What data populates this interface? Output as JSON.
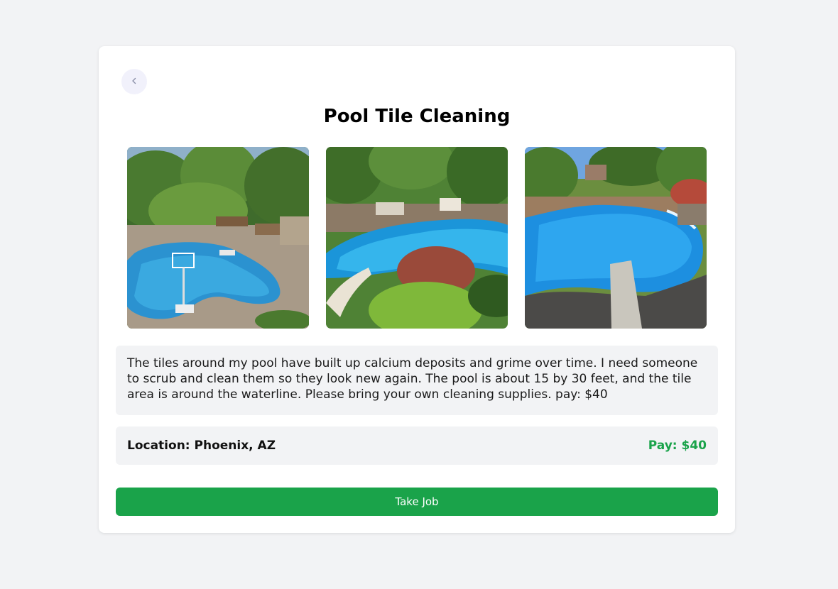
{
  "job": {
    "title": "Pool Tile Cleaning",
    "description": "The tiles around my pool have built up calcium deposits and grime over time. I need someone to scrub and clean them so they look new again. The pool is about 15 by 30 feet, and the tile area is around the waterline. Please bring your own cleaning supplies. pay: $40",
    "location": "Location: Phoenix, AZ",
    "pay": "Pay: $40"
  },
  "actions": {
    "take_job_label": "Take Job",
    "back_icon": "chevron-left-icon"
  },
  "photos": [
    {
      "name": "pool-photo-1"
    },
    {
      "name": "pool-photo-2"
    },
    {
      "name": "pool-photo-3"
    }
  ],
  "colors": {
    "accent_green": "#1aa34a",
    "background": "#f2f3f5",
    "back_button_bg": "#f1f1fb"
  }
}
